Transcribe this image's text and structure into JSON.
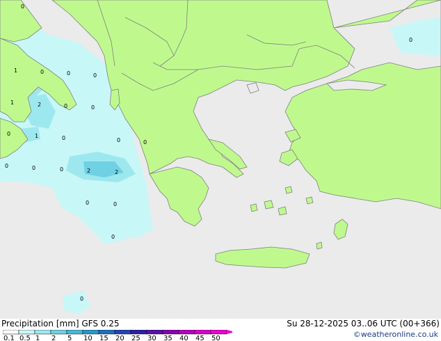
{
  "title": "Precipitation [mm] GFS 0.25",
  "datetime": "Su 28-12-2025 03..06 UTC (00+366)",
  "credit": "©weatheronline.co.uk",
  "colors": {
    "sea": "#ebebeb",
    "land": "#bff98e",
    "coast": "#7f7f7f",
    "precip_light": "#c8f7f7",
    "precip_mid": "#9de8ef",
    "precip_heavy": "#6fd1e3"
  },
  "legend": {
    "labels": [
      "0.1",
      "0.5",
      "1",
      "2",
      "5",
      "10",
      "15",
      "20",
      "25",
      "30",
      "35",
      "40",
      "45",
      "50"
    ],
    "colors": [
      "#fdfdfd",
      "#c8f7f7",
      "#9de8ef",
      "#6fd1e3",
      "#47b8d8",
      "#2a96c9",
      "#1f6fc0",
      "#2445b3",
      "#2c1fa8",
      "#5a10a8",
      "#8a00b0",
      "#b800c0",
      "#dd00cc",
      "#f000d8"
    ]
  },
  "precip_labels": [
    "0",
    "1",
    "0",
    "0",
    "0",
    "1",
    "2",
    "0",
    "0",
    "0",
    "1",
    "0",
    "0",
    "0",
    "0",
    "0",
    "2",
    "2",
    "0",
    "0",
    "0",
    "0",
    "0",
    "0"
  ]
}
